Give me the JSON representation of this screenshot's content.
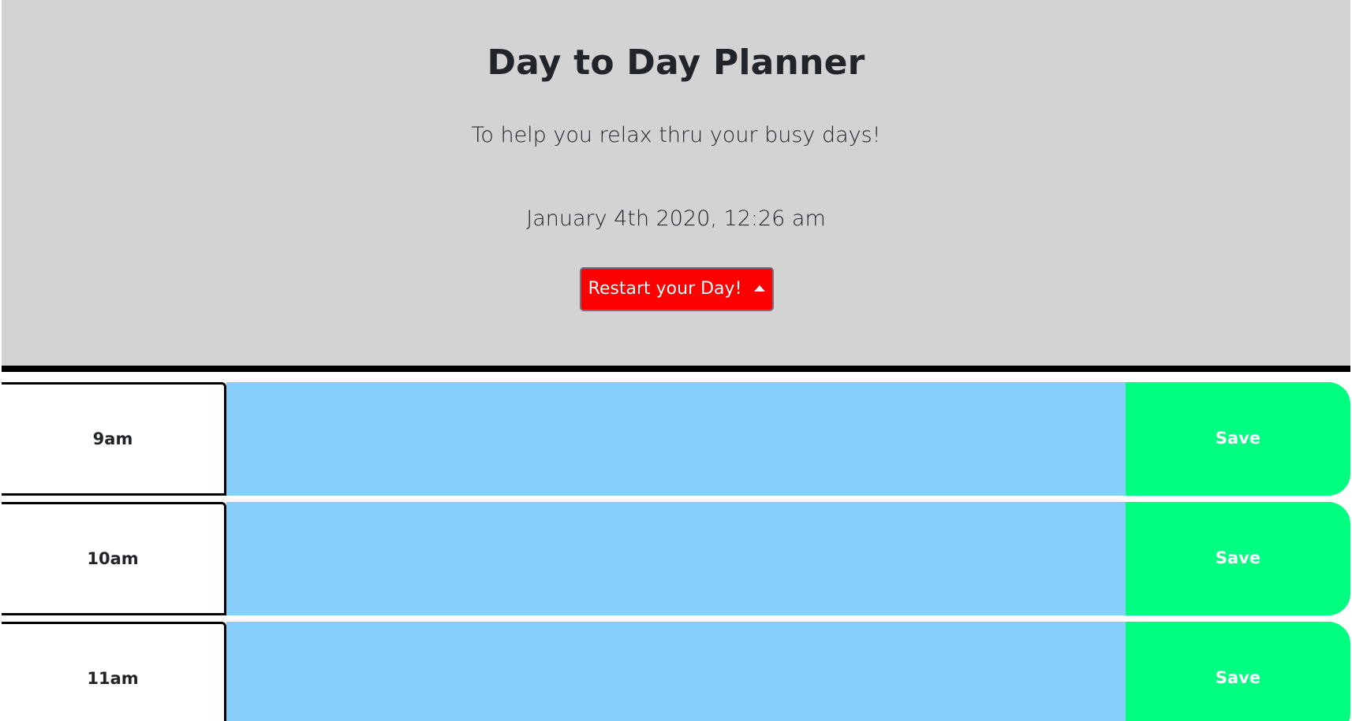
{
  "header": {
    "title": "Day to Day Planner",
    "subtitle": "To help you relax thru your busy days!",
    "current_datetime": "January 4th 2020, 12:26 am",
    "restart_label": "Restart your Day!",
    "restart_icon": "caret-up-icon"
  },
  "colors": {
    "header_bg": "#d3d3d3",
    "restart_bg": "#ff0000",
    "task_bg": "#87cefa",
    "save_bg": "#00ff80"
  },
  "schedule": [
    {
      "hour": "9am",
      "task": "",
      "save_label": "Save"
    },
    {
      "hour": "10am",
      "task": "",
      "save_label": "Save"
    },
    {
      "hour": "11am",
      "task": "",
      "save_label": "Save"
    }
  ]
}
